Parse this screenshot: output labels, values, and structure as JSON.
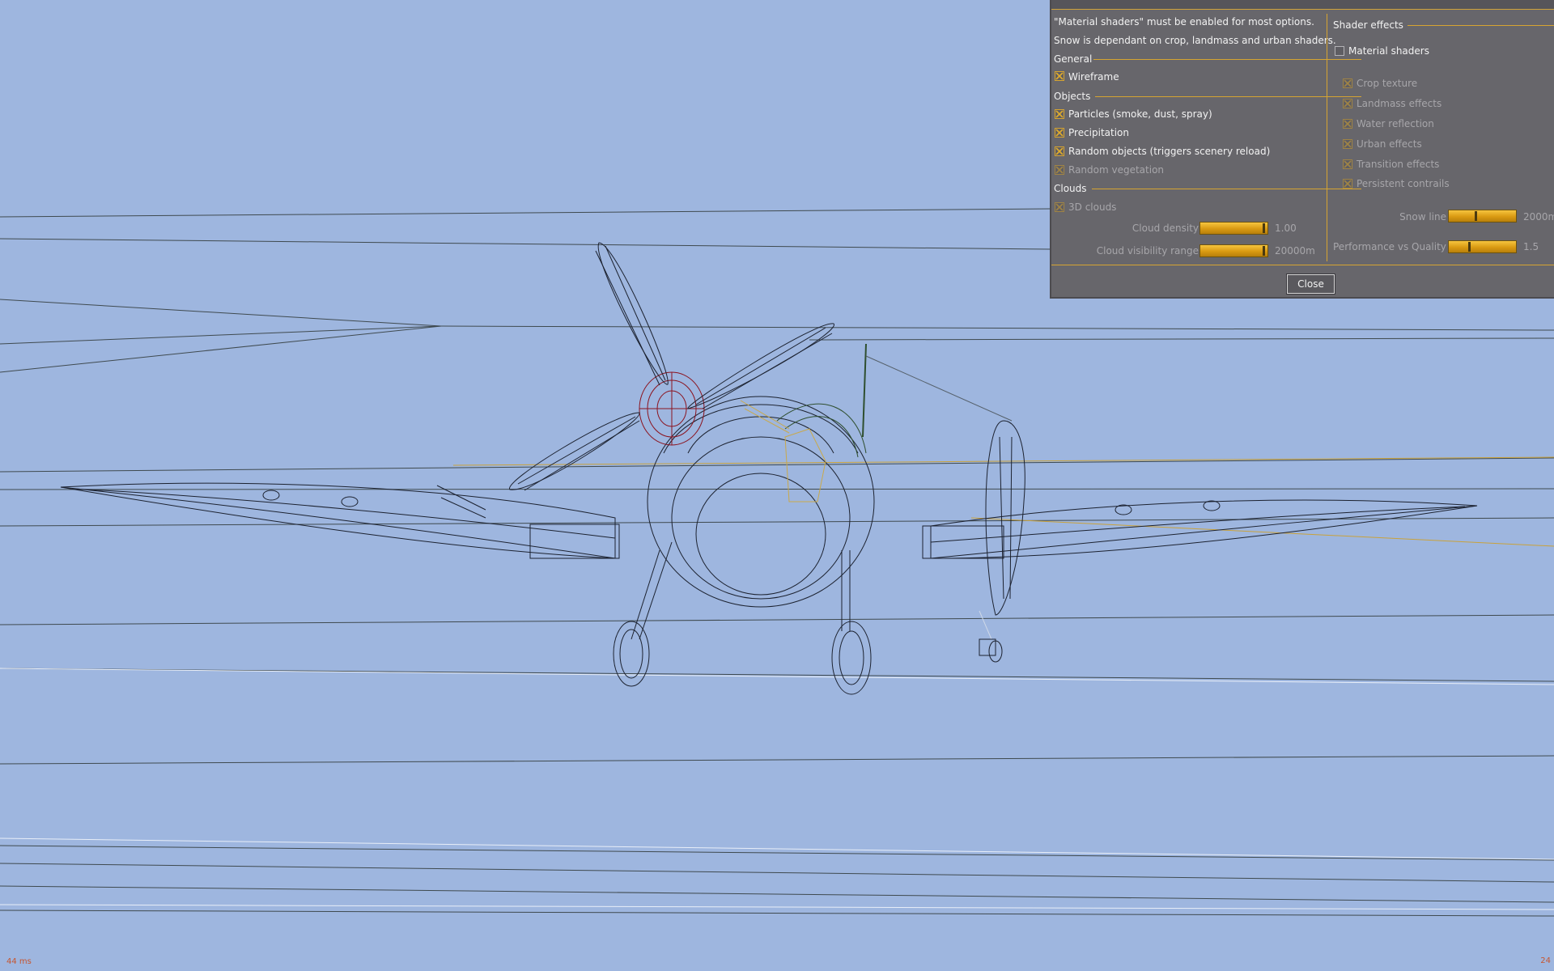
{
  "dialog": {
    "notes": [
      "\"Material shaders\" must be enabled for most options.",
      "Snow is dependant on crop, landmass and urban shaders."
    ],
    "general": {
      "label": "General",
      "wireframe": {
        "label": "Wireframe",
        "checked": true
      }
    },
    "objects": {
      "label": "Objects",
      "particles": {
        "label": "Particles (smoke, dust, spray)",
        "checked": true
      },
      "precipitation": {
        "label": "Precipitation",
        "checked": true
      },
      "random_objects": {
        "label": "Random objects (triggers scenery reload)",
        "checked": true
      },
      "random_vegetation": {
        "label": "Random vegetation",
        "checked": true,
        "enabled": false
      }
    },
    "clouds": {
      "label": "Clouds",
      "clouds_3d": {
        "label": "3D clouds",
        "checked": true,
        "enabled": false
      },
      "cloud_density": {
        "label": "Cloud density",
        "value": "1.00",
        "fraction": 0.97
      },
      "cloud_visibility": {
        "label": "Cloud visibility range",
        "value": "20000m",
        "fraction": 0.97
      }
    },
    "shader_effects": {
      "label": "Shader effects",
      "material_shaders": {
        "label": "Material shaders",
        "checked": false
      },
      "crop_texture": {
        "label": "Crop texture",
        "checked": true,
        "enabled": false
      },
      "landmass_effects": {
        "label": "Landmass effects",
        "checked": true,
        "enabled": false
      },
      "water_reflection": {
        "label": "Water reflection",
        "checked": true,
        "enabled": false
      },
      "urban_effects": {
        "label": "Urban effects",
        "checked": true,
        "enabled": false
      },
      "transition_effects": {
        "label": "Transition effects",
        "checked": true,
        "enabled": false
      },
      "persistent_contrails": {
        "label": "Persistent contrails",
        "checked": true,
        "enabled": false
      },
      "snow_line": {
        "label": "Snow line",
        "value": "2000m",
        "fraction": 0.4
      },
      "performance_quality": {
        "label": "Performance vs Quality",
        "value": "1.5",
        "fraction": 0.3
      }
    },
    "close_label": "Close"
  },
  "hud": {
    "frame_time": "44 ms",
    "fps": "24"
  },
  "colors": {
    "sky": "#9eb6df",
    "dialog_bg": "#67666b",
    "accent": "#d6a431",
    "wire": "#1c2230"
  }
}
